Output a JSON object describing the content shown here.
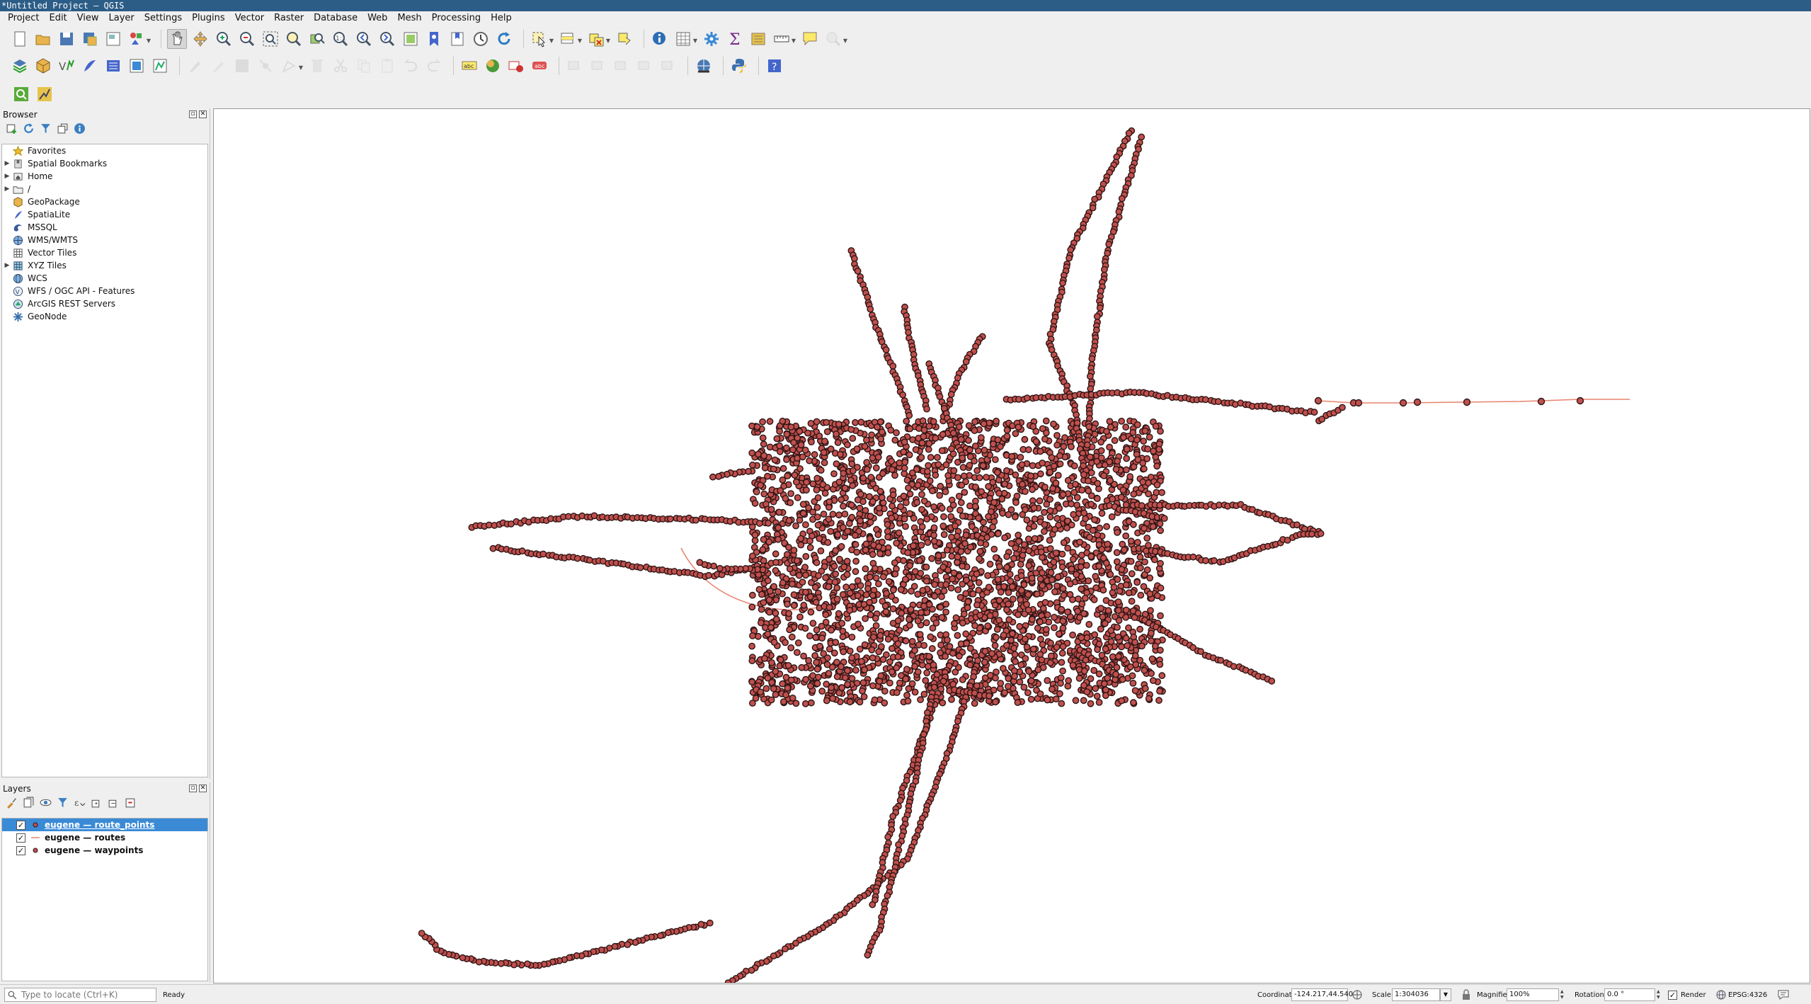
{
  "window": {
    "title": "*Untitled Project — QGIS"
  },
  "menu": [
    "Project",
    "Edit",
    "View",
    "Layer",
    "Settings",
    "Plugins",
    "Vector",
    "Raster",
    "Database",
    "Web",
    "Mesh",
    "Processing",
    "Help"
  ],
  "toolbar1": [
    "new-project-icon",
    "open-project-icon",
    "save-project-icon",
    "save-as-icon",
    "print-layout-icon",
    "style-manager-icon",
    "|",
    "pan-icon",
    "pan-to-selection-icon",
    "zoom-in-icon",
    "zoom-out-icon",
    "zoom-full-icon",
    "zoom-to-selection-icon",
    "zoom-to-layer-icon",
    "zoom-native-icon",
    "zoom-last-icon",
    "zoom-next-icon",
    "new-map-view-icon",
    "new-bookmark-icon",
    "show-bookmarks-icon",
    "temporal-controller-icon",
    "refresh-icon",
    "|",
    "select-features-icon",
    "select-by-value-icon",
    "deselect-icon",
    "select-location-icon",
    "|",
    "identify-icon",
    "attribute-table-icon",
    "processing-toolbox-icon",
    "statistics-icon",
    "field-calculator-icon",
    "measure-icon",
    "annotation-icon",
    "spatial-query-icon"
  ],
  "toolbar2": [
    "data-source-manager-icon",
    "new-geopackage-icon",
    "new-shapefile-icon",
    "new-spatialite-icon",
    "new-temp-layer-icon",
    "new-virtual-layer-icon",
    "georeferencer-icon",
    "|",
    "current-edits-icon",
    "toggle-editing-icon",
    "save-edits-icon",
    "add-feature-icon",
    "vertex-tool-icon",
    "delete-selected-icon",
    "cut-features-icon",
    "copy-features-icon",
    "paste-features-icon",
    "undo-icon",
    "redo-icon",
    "|",
    "label-toolbar-icon",
    "label-pin-icon",
    "label-highlight-icon",
    "label-show-hide-icon",
    "|",
    "label-move-icon",
    "label-rotate-icon",
    "label-change-icon",
    "diagram-move-icon",
    "diagram-change-icon",
    "|",
    "gps-connect-icon",
    "|",
    "python-console-icon",
    "|",
    "whats-this-icon"
  ],
  "toolbar3": [
    "locator-search-icon",
    "plugin-tool-icon"
  ],
  "browser": {
    "title": "Browser",
    "items": [
      {
        "label": "Favorites",
        "icon": "star-icon",
        "expandable": false
      },
      {
        "label": "Spatial Bookmarks",
        "icon": "bookmark-icon",
        "expandable": true
      },
      {
        "label": "Home",
        "icon": "home-folder-icon",
        "expandable": true
      },
      {
        "label": "/",
        "icon": "folder-icon",
        "expandable": true
      },
      {
        "label": "GeoPackage",
        "icon": "geopackage-icon",
        "expandable": false
      },
      {
        "label": "SpatiaLite",
        "icon": "spatialite-icon",
        "expandable": false
      },
      {
        "label": "MSSQL",
        "icon": "mssql-icon",
        "expandable": false
      },
      {
        "label": "WMS/WMTS",
        "icon": "wms-icon",
        "expandable": false
      },
      {
        "label": "Vector Tiles",
        "icon": "vector-tiles-icon",
        "expandable": false
      },
      {
        "label": "XYZ Tiles",
        "icon": "xyz-tiles-icon",
        "expandable": true
      },
      {
        "label": "WCS",
        "icon": "wcs-icon",
        "expandable": false
      },
      {
        "label": "WFS / OGC API - Features",
        "icon": "wfs-icon",
        "expandable": false
      },
      {
        "label": "ArcGIS REST Servers",
        "icon": "arcgis-icon",
        "expandable": false
      },
      {
        "label": "GeoNode",
        "icon": "geonode-icon",
        "expandable": false
      }
    ]
  },
  "layers": {
    "title": "Layers",
    "items": [
      {
        "label": "eugene — route_points",
        "checked": true,
        "symbol": "point",
        "selected": true
      },
      {
        "label": "eugene — routes",
        "checked": true,
        "symbol": "line",
        "selected": false
      },
      {
        "label": "eugene — waypoints",
        "checked": true,
        "symbol": "point",
        "selected": false
      }
    ]
  },
  "colors": {
    "point_fill": "#c0504d",
    "point_stroke": "#2d1515",
    "line": "#e8826e",
    "selection": "#3a8ad6",
    "titlebar": "#2c5d87"
  },
  "statusbar": {
    "locator_placeholder": "Type to locate (Ctrl+K)",
    "status": "Ready",
    "coordinate_label": "Coordinate",
    "coordinate_value": "-124.217,44.540",
    "scale_label": "Scale",
    "scale_value": "1:304036",
    "magnifier_label": "Magnifier",
    "magnifier_value": "100%",
    "rotation_label": "Rotation",
    "rotation_value": "0.0 °",
    "render_label": "Render",
    "crs": "EPSG:4326"
  }
}
